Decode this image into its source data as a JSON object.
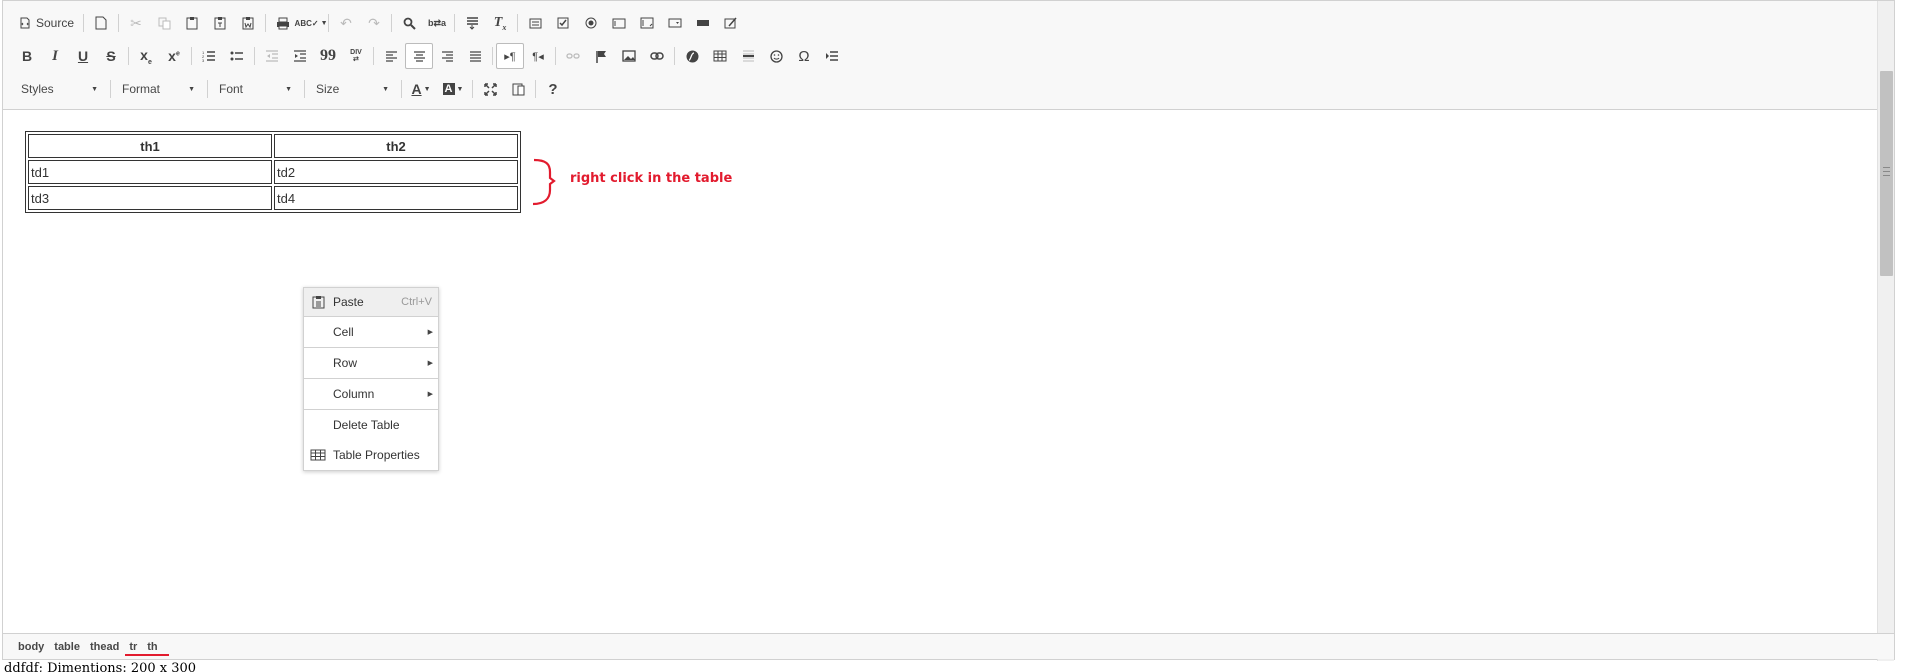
{
  "toolbar": {
    "source_label": "Source",
    "combos": {
      "styles": "Styles",
      "format": "Format",
      "font": "Font",
      "size": "Size"
    },
    "buttons": {
      "bold": "B",
      "italic": "I",
      "underline": "U",
      "strike": "S",
      "blockquote": "99",
      "special_char": "Ω",
      "help": "?"
    }
  },
  "content": {
    "table": {
      "headers": [
        "th1",
        "th2"
      ],
      "rows": [
        [
          "td1",
          "td2"
        ],
        [
          "td3",
          "td4"
        ]
      ]
    },
    "annotation": "right click in the table",
    "annotation_color": "#e21b2e"
  },
  "context_menu": {
    "paste": {
      "label": "Paste",
      "shortcut": "Ctrl+V"
    },
    "cell": "Cell",
    "row": "Row",
    "column": "Column",
    "delete_table": "Delete Table",
    "table_properties": "Table Properties"
  },
  "statusbar": {
    "path": [
      "body",
      "table",
      "thead",
      "tr",
      "th"
    ]
  },
  "footer_text": "ddfdf; Dimentions: 200 x 300"
}
